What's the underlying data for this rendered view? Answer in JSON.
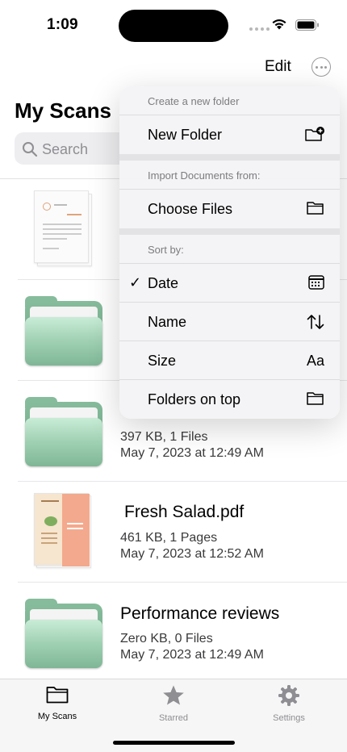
{
  "status_bar": {
    "time": "1:09"
  },
  "nav": {
    "edit_label": "Edit",
    "more_icon": "ellipsis-circle-icon"
  },
  "page_title": "My Scans",
  "search": {
    "placeholder": "Search"
  },
  "items": [
    {
      "type": "document",
      "name": "",
      "meta_line1": "",
      "meta_line2": ""
    },
    {
      "type": "folder",
      "name": "",
      "meta_line1": "",
      "meta_line2": ""
    },
    {
      "type": "folder",
      "name": "",
      "meta_line1": "397 KB, 1 Files",
      "meta_line2": "May 7, 2023 at 12:49 AM"
    },
    {
      "type": "document",
      "name": "Fresh Salad.pdf",
      "meta_line1": "461 KB, 1 Pages",
      "meta_line2": "May 7, 2023 at 12:52 AM"
    },
    {
      "type": "folder",
      "name": "Performance reviews",
      "meta_line1": "Zero KB, 0 Files",
      "meta_line2": "May 7, 2023 at 12:49 AM"
    }
  ],
  "menu": {
    "sections": [
      {
        "header": "Create a new folder",
        "items": [
          {
            "label": "New Folder",
            "icon": "folder-badge-plus-icon",
            "checked": false
          }
        ]
      },
      {
        "header": "Import Documents from:",
        "items": [
          {
            "label": "Choose Files",
            "icon": "folder-icon",
            "checked": false
          }
        ]
      },
      {
        "header": "Sort by:",
        "items": [
          {
            "label": "Date",
            "icon": "calendar-icon",
            "checked": true
          },
          {
            "label": "Name",
            "icon": "arrow-up-down-icon",
            "checked": false
          },
          {
            "label": "Size",
            "icon": "text-size-icon",
            "icon_text": "Aa",
            "checked": false
          },
          {
            "label": "Folders on top",
            "icon": "folder-icon",
            "checked": false
          }
        ]
      }
    ],
    "checkmark": "✓"
  },
  "tabbar": {
    "tabs": [
      {
        "label": "My Scans",
        "icon": "folder-icon",
        "active": true
      },
      {
        "label": "Starred",
        "icon": "star-icon",
        "active": false
      },
      {
        "label": "Settings",
        "icon": "gear-icon",
        "active": false
      }
    ]
  },
  "colors": {
    "folder_green": "#9fd0b2",
    "inactive_gray": "#8e8e93",
    "menu_bg": "#f4f4f6"
  }
}
